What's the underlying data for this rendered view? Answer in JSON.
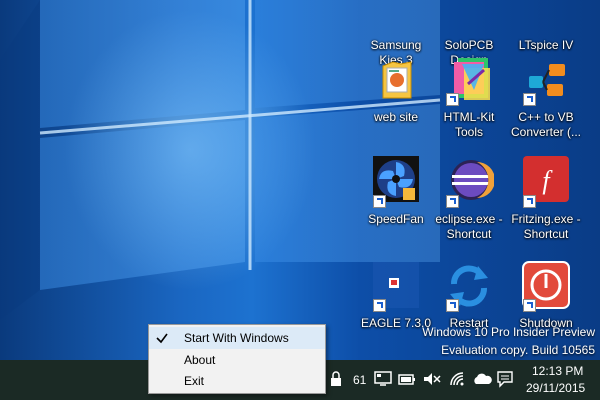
{
  "desktop": {
    "icons": [
      {
        "label_lines": [
          "Samsung",
          "Kies 3"
        ],
        "icon": "samsung-kies-icon"
      },
      {
        "label_lines": [
          "SoloPCB",
          "Design"
        ],
        "icon": "solopcb-icon"
      },
      {
        "label_lines": [
          "LTspice IV"
        ],
        "icon": "ltspice-icon"
      },
      {
        "label_lines": [
          "web site"
        ],
        "icon": "folder-icon"
      },
      {
        "label_lines": [
          "HTML-Kit",
          "Tools"
        ],
        "icon": "html-kit-icon"
      },
      {
        "label_lines": [
          "C++ to VB",
          "Converter (..."
        ],
        "icon": "converter-icon"
      },
      {
        "label_lines": [
          "SpeedFan"
        ],
        "icon": "speedfan-icon"
      },
      {
        "label_lines": [
          "eclipse.exe -",
          "Shortcut"
        ],
        "icon": "eclipse-icon"
      },
      {
        "label_lines": [
          "Fritzing.exe -",
          "Shortcut"
        ],
        "icon": "fritzing-icon"
      },
      {
        "label_lines": [
          "EAGLE 7.3.0"
        ],
        "icon": "eagle-icon"
      },
      {
        "label_lines": [
          "Restart"
        ],
        "icon": "restart-icon"
      },
      {
        "label_lines": [
          "Shutdown"
        ],
        "icon": "shutdown-icon"
      }
    ],
    "watermark": {
      "line1": "Windows 10 Pro Insider Preview",
      "line2": "Evaluation copy. Build 10565"
    }
  },
  "context_menu": {
    "items": [
      {
        "label": "Start With Windows",
        "checked": true
      },
      {
        "label": "About"
      },
      {
        "label": "Exit"
      }
    ]
  },
  "taskbar": {
    "tray_number": "61",
    "time": "12:13 PM",
    "date": "29/11/2015"
  },
  "colors": {
    "taskbar": "#1b2a25",
    "menu_highlight": "#dceaf7",
    "fritzing_red": "#d32f2f",
    "shutdown_red": "#e24a3b"
  }
}
